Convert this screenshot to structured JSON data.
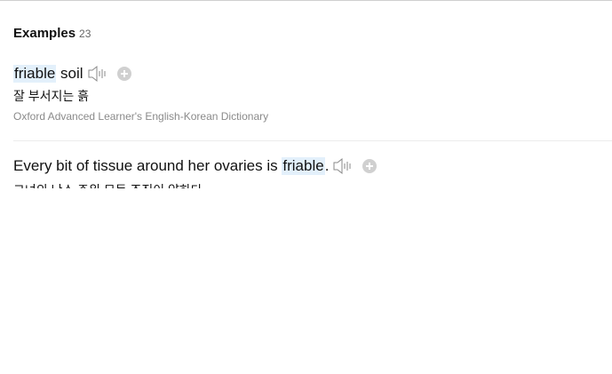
{
  "section": {
    "title": "Examples",
    "count": "23"
  },
  "examples": [
    {
      "sentence_highlight": "friable",
      "sentence_after": " soil",
      "translation": "잘 부서지는 흙",
      "source": "Oxford Advanced Learner's English-Korean Dictionary"
    },
    {
      "sentence_before": "Every bit of tissue around her ovaries is ",
      "sentence_highlight": "friable",
      "sentence_after": ".",
      "translation": "그녀의 난소 주위 모든 조직이 약하다"
    }
  ],
  "icons": {
    "speaker": "speaker-icon",
    "add": "plus-circle-icon"
  },
  "colors": {
    "highlight": "#e3f0fb",
    "muted": "#8a8a8a",
    "add_button": "#d0d0d0"
  }
}
